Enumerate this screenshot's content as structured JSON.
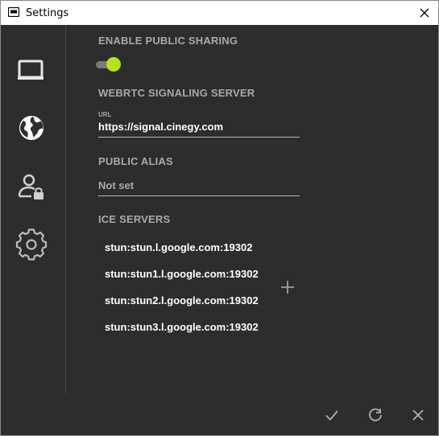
{
  "window": {
    "title": "Settings"
  },
  "sidebar": {
    "items": [
      {
        "icon": "monitor-icon"
      },
      {
        "icon": "globe-icon"
      },
      {
        "icon": "user-lock-icon"
      },
      {
        "icon": "gear-icon"
      }
    ]
  },
  "sharing": {
    "title": "ENABLE PUBLIC SHARING",
    "enabled": true
  },
  "signaling": {
    "title": "WEBRTC SIGNALING SERVER",
    "url_label": "URL",
    "url_value": "https://signal.cinegy.com"
  },
  "alias": {
    "title": "PUBLIC ALIAS",
    "placeholder": "Not set"
  },
  "ice": {
    "title": "ICE SERVERS",
    "servers": [
      "stun:stun.l.google.com:19302",
      "stun:stun1.l.google.com:19302",
      "stun:stun2.l.google.com:19302",
      "stun:stun3.l.google.com:19302"
    ]
  },
  "colors": {
    "background": "#2d2d2d",
    "accent": "#b6e317",
    "section_title": "#a9a9a9"
  }
}
